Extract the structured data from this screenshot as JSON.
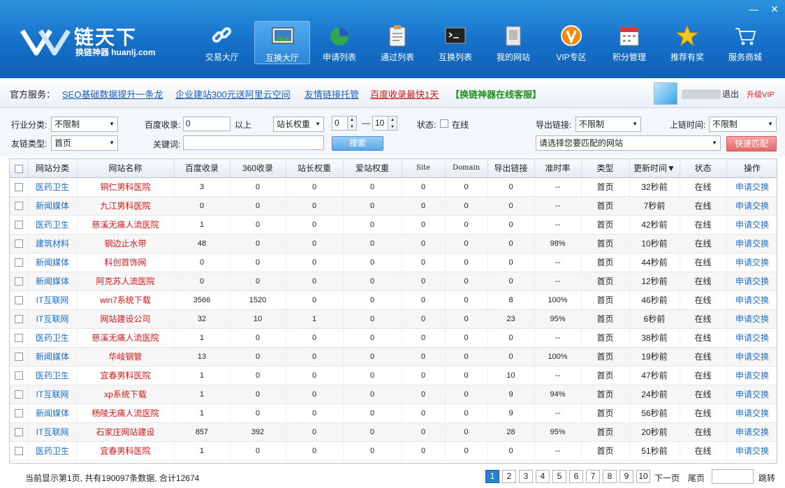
{
  "window": {
    "minimize_icon": "minimize-icon",
    "close_icon": "close-icon",
    "minimize_glyph": "—",
    "close_glyph": "✕"
  },
  "logo": {
    "title": "链天下",
    "subtitle": "换链神器 huanlj.com"
  },
  "nav": [
    {
      "label": "交易大厅",
      "icon": "chain-link-icon",
      "active": false
    },
    {
      "label": "互换大厅",
      "icon": "monitor-picture-icon",
      "active": true
    },
    {
      "label": "申请列表",
      "icon": "pie-chart-icon",
      "active": false
    },
    {
      "label": "通过列表",
      "icon": "clipboard-icon",
      "active": false
    },
    {
      "label": "互换列表",
      "icon": "console-window-icon",
      "active": false
    },
    {
      "label": "我的网站",
      "icon": "web-page-icon",
      "active": false
    },
    {
      "label": "VIP专区",
      "icon": "vip-badge-icon",
      "active": false
    },
    {
      "label": "积分管理",
      "icon": "calendar-icon",
      "active": false
    },
    {
      "label": "推荐有奖",
      "icon": "star-icon",
      "active": false
    },
    {
      "label": "服务商城",
      "icon": "shopping-cart-icon",
      "active": false
    }
  ],
  "announcements": {
    "label": "官方服务：",
    "links": [
      {
        "text": "SEO基础数据提升一条龙",
        "color": "#1f5fb8"
      },
      {
        "text": "企业建站300元送阿里云空间",
        "color": "#1f5fb8"
      },
      {
        "text": "友情链接托管",
        "color": "#1f5fb8"
      },
      {
        "text": "百度收录最快1天",
        "color": "#d01818"
      },
      {
        "text": "【换链神器在线客服】",
        "color": "#1f8f1f"
      }
    ]
  },
  "user": {
    "logout": "退出",
    "upgrade": "升级VIP"
  },
  "filters": {
    "industry_label": "行业分类:",
    "industry_value": "不限制",
    "baidu_label": "百度收录:",
    "baidu_value": "0",
    "baidu_suffix": "以上",
    "weight_select": "站长权重",
    "weight_min": "0",
    "weight_dash": "—",
    "weight_max": "10",
    "status_label": "状态:",
    "status_option": "在线",
    "export_label": "导出链接:",
    "export_value": "不限制",
    "time_label": "上链时间:",
    "time_value": "不限制",
    "linktype_label": "友链类型:",
    "linktype_value": "首页",
    "keyword_label": "关键词:",
    "keyword_value": "",
    "search_button": "搜索",
    "site_select": "请选择您要匹配的网站",
    "match_button": "快速匹配"
  },
  "table": {
    "headers": [
      "网站分类",
      "网站名称",
      "百度收录",
      "360收录",
      "站长权重",
      "爱站权重",
      "Site",
      "Domain",
      "导出链接",
      "准时率",
      "类型",
      "更新时间▼",
      "状态",
      "操作"
    ],
    "rows": [
      [
        "医药卫生",
        "铜仁男科医院",
        "3",
        "0",
        "0",
        "0",
        "0",
        "0",
        "0",
        "--",
        "首页",
        "32秒前",
        "在线",
        "申请交换"
      ],
      [
        "新闻媒体",
        "九江男科医院",
        "0",
        "0",
        "0",
        "0",
        "0",
        "0",
        "0",
        "--",
        "首页",
        "7秒前",
        "在线",
        "申请交换"
      ],
      [
        "医药卫生",
        "慈溪无痛人流医院",
        "1",
        "0",
        "0",
        "0",
        "0",
        "0",
        "0",
        "--",
        "首页",
        "42秒前",
        "在线",
        "申请交换"
      ],
      [
        "建筑材料",
        "钢边止水带",
        "48",
        "0",
        "0",
        "0",
        "0",
        "0",
        "0",
        "98%",
        "首页",
        "10秒前",
        "在线",
        "申请交换"
      ],
      [
        "新闻媒体",
        "科创首饰网",
        "0",
        "0",
        "0",
        "0",
        "0",
        "0",
        "0",
        "--",
        "首页",
        "44秒前",
        "在线",
        "申请交换"
      ],
      [
        "新闻媒体",
        "阿克苏人流医院",
        "0",
        "0",
        "0",
        "0",
        "0",
        "0",
        "0",
        "--",
        "首页",
        "12秒前",
        "在线",
        "申请交换"
      ],
      [
        "IT互联网",
        "win7系统下载",
        "3566",
        "1520",
        "0",
        "0",
        "0",
        "0",
        "8",
        "100%",
        "首页",
        "46秒前",
        "在线",
        "申请交换"
      ],
      [
        "IT互联网",
        "网站建设公司",
        "32",
        "10",
        "1",
        "0",
        "0",
        "0",
        "23",
        "95%",
        "首页",
        "6秒前",
        "在线",
        "申请交换"
      ],
      [
        "医药卫生",
        "慈溪无痛人流医院",
        "1",
        "0",
        "0",
        "0",
        "0",
        "0",
        "0",
        "--",
        "首页",
        "38秒前",
        "在线",
        "申请交换"
      ],
      [
        "新闻媒体",
        "华岐钢管",
        "13",
        "0",
        "0",
        "0",
        "0",
        "0",
        "0",
        "100%",
        "首页",
        "19秒前",
        "在线",
        "申请交换"
      ],
      [
        "医药卫生",
        "宜春男科医院",
        "1",
        "0",
        "0",
        "0",
        "0",
        "0",
        "10",
        "--",
        "首页",
        "47秒前",
        "在线",
        "申请交换"
      ],
      [
        "IT互联网",
        "xp系统下载",
        "1",
        "0",
        "0",
        "0",
        "0",
        "0",
        "9",
        "94%",
        "首页",
        "24秒前",
        "在线",
        "申请交换"
      ],
      [
        "新闻媒体",
        "杨陵无痛人流医院",
        "1",
        "0",
        "0",
        "0",
        "0",
        "0",
        "9",
        "--",
        "首页",
        "56秒前",
        "在线",
        "申请交换"
      ],
      [
        "IT互联网",
        "石家庄网站建设",
        "857",
        "392",
        "0",
        "0",
        "0",
        "0",
        "28",
        "95%",
        "首页",
        "20秒前",
        "在线",
        "申请交换"
      ],
      [
        "医药卫生",
        "宜春男科医院",
        "1",
        "0",
        "0",
        "0",
        "0",
        "0",
        "0",
        "--",
        "首页",
        "51秒前",
        "在线",
        "申请交换"
      ]
    ]
  },
  "footer": {
    "info": "当前显示第1页, 共有190097条数据, 合计12674",
    "pages": [
      "1",
      "2",
      "3",
      "4",
      "5",
      "6",
      "7",
      "8",
      "9",
      "10"
    ],
    "current_page": "1",
    "next": "下一页",
    "last": "尾页",
    "jump": "跳转"
  },
  "colors": {
    "header_blue": "#1670c8",
    "link_blue": "#1e6fc8",
    "name_red": "#d01818",
    "green": "#1f8f1f"
  }
}
